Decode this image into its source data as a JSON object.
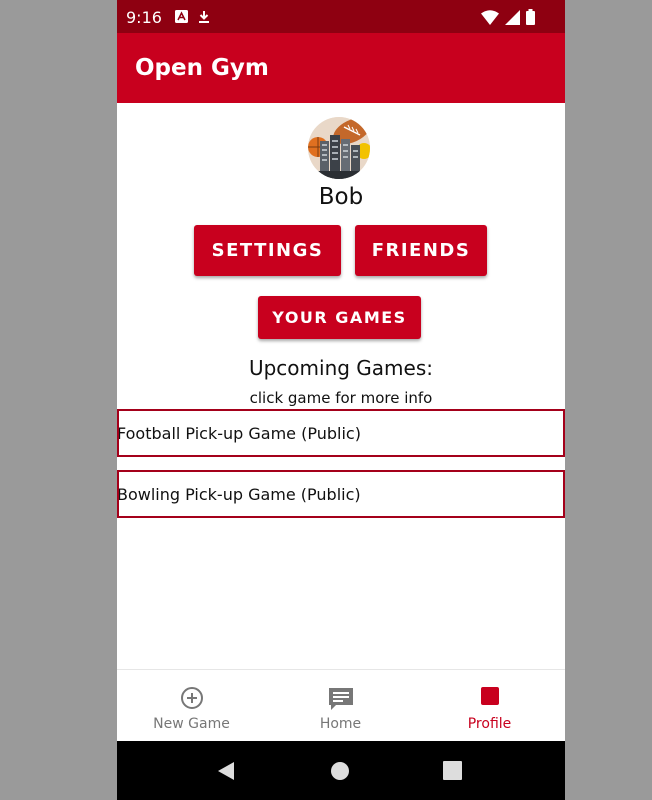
{
  "status_bar": {
    "time": "9:16"
  },
  "app_bar": {
    "title": "Open Gym"
  },
  "profile": {
    "name": "Bob"
  },
  "buttons": {
    "settings": "SETTINGS",
    "friends": "FRIENDS",
    "your_games": "YOUR GAMES"
  },
  "upcoming": {
    "title": "Upcoming Games:",
    "subtitle": "click game for more info",
    "games": [
      "Football Pick-up Game (Public)",
      "Bowling Pick-up Game (Public)"
    ]
  },
  "bottom_nav": {
    "items": [
      {
        "label": "New Game",
        "icon": "add-circle-icon"
      },
      {
        "label": "Home",
        "icon": "chat-icon"
      },
      {
        "label": "Profile",
        "icon": "profile-square-icon",
        "active": true
      }
    ]
  },
  "colors": {
    "primary": "#c8001e",
    "primary_dark": "#8e0011",
    "outline": "#a4001a"
  }
}
